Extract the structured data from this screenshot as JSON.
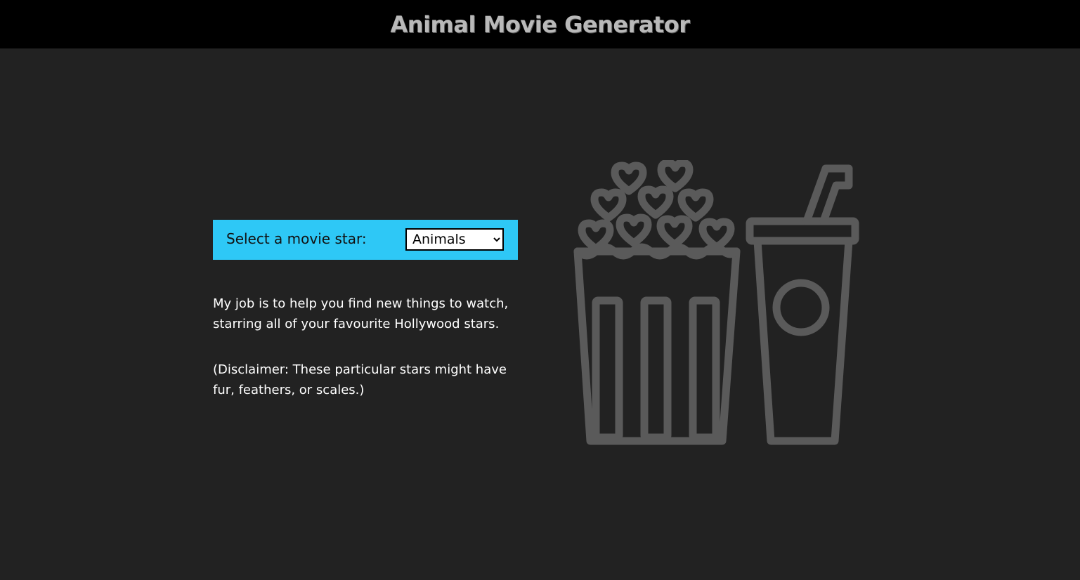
{
  "header": {
    "title": "Animal Movie Generator"
  },
  "selector": {
    "label": "Select a movie star:",
    "selected": "Animals"
  },
  "description": {
    "paragraph1": "My job is to help you find new things to watch, starring all of your favourite Hollywood stars.",
    "paragraph2": "(Disclaimer: These particular stars might have fur, feathers, or scales.)"
  },
  "colors": {
    "background": "#222222",
    "header_bg": "#000000",
    "accent": "#2ec8f6",
    "illustration": "#5a5a5a"
  },
  "icons": {
    "illustration": "popcorn-and-soda-icon"
  }
}
